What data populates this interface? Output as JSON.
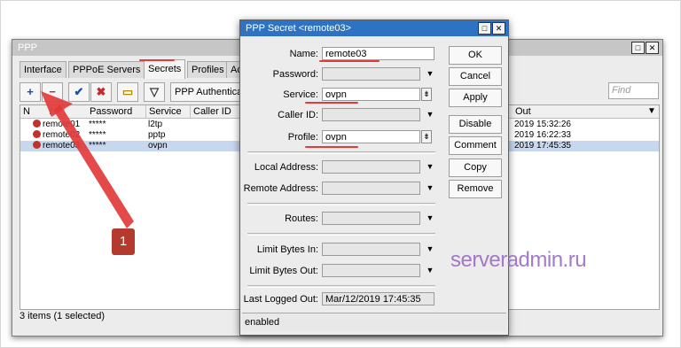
{
  "main_window": {
    "title": "PPP",
    "tabs": [
      {
        "label": "Interface"
      },
      {
        "label": "PPPoE Servers"
      },
      {
        "label": "Secrets"
      },
      {
        "label": "Profiles"
      },
      {
        "label": "Active"
      }
    ],
    "active_tab": "Secrets",
    "toolbar": {
      "add": "+",
      "remove": "−",
      "enable": "✔",
      "disable": "✖",
      "comment": "▭",
      "filter": "▽",
      "auth_button": "PPP Authenticat"
    },
    "find_placeholder": "Find",
    "columns": [
      "N",
      "/",
      "Password",
      "Service",
      "Caller ID",
      "Out"
    ],
    "rows": [
      {
        "name": "remote01",
        "password": "*****",
        "service": "l2tp",
        "last_out": "2019 15:32:26",
        "selected": false
      },
      {
        "name": "remote02",
        "password": "*****",
        "service": "pptp",
        "last_out": "2019 16:22:33",
        "selected": false
      },
      {
        "name": "remote03",
        "password": "*****",
        "service": "ovpn",
        "last_out": "2019 17:45:35",
        "selected": true
      }
    ],
    "status": "3 items (1 selected)"
  },
  "dialog": {
    "title": "PPP Secret <remote03>",
    "fields": {
      "name": {
        "label": "Name:",
        "value": "remote03"
      },
      "password": {
        "label": "Password:",
        "value": ""
      },
      "service": {
        "label": "Service:",
        "value": "ovpn"
      },
      "caller_id": {
        "label": "Caller ID:",
        "value": ""
      },
      "profile": {
        "label": "Profile:",
        "value": "ovpn"
      },
      "local_address": {
        "label": "Local Address:",
        "value": ""
      },
      "remote_address": {
        "label": "Remote Address:",
        "value": ""
      },
      "routes": {
        "label": "Routes:",
        "value": ""
      },
      "limit_in": {
        "label": "Limit Bytes In:",
        "value": ""
      },
      "limit_out": {
        "label": "Limit Bytes Out:",
        "value": ""
      },
      "last_logged_out": {
        "label": "Last Logged Out:",
        "value": "Mar/12/2019 17:45:35"
      }
    },
    "buttons": {
      "ok": "OK",
      "cancel": "Cancel",
      "apply": "Apply",
      "disable": "Disable",
      "comment": "Comment",
      "copy": "Copy",
      "remove": "Remove"
    },
    "status": "enabled"
  },
  "annotation": {
    "badge": "1",
    "watermark": "serveradmin.ru",
    "highlight_color": "#e23b3b"
  },
  "colors": {
    "dialog_titlebar": "#2e73c3",
    "selection": "#c7d7ee"
  }
}
